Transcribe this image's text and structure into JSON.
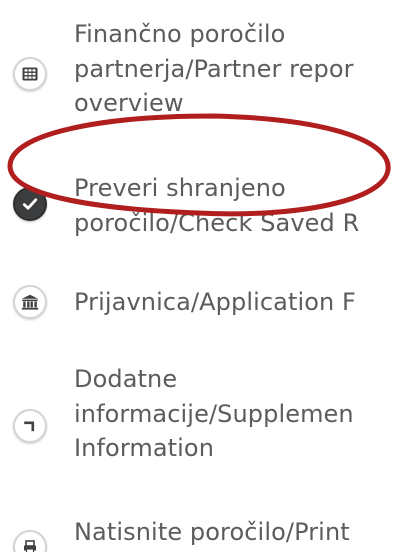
{
  "menu": {
    "items": [
      {
        "icon": "calculator-icon",
        "lines": [
          "Finančno poročilo",
          "partnerja/Partner repor",
          "overview"
        ]
      },
      {
        "icon": "check-circle-icon",
        "lines": [
          "Preveri shranjeno",
          "poročilo/Check Saved R"
        ]
      },
      {
        "icon": "bank-icon",
        "lines": [
          "Prijavnica/Application F"
        ]
      },
      {
        "icon": "corner-arrow-icon",
        "lines": [
          "Dodatne",
          "informacije/Supplemen",
          "Information"
        ]
      },
      {
        "icon": "print-icon",
        "lines": [
          "Natisnite poročilo/Print"
        ]
      }
    ]
  },
  "annotation": {
    "color": "#b01e1e"
  }
}
